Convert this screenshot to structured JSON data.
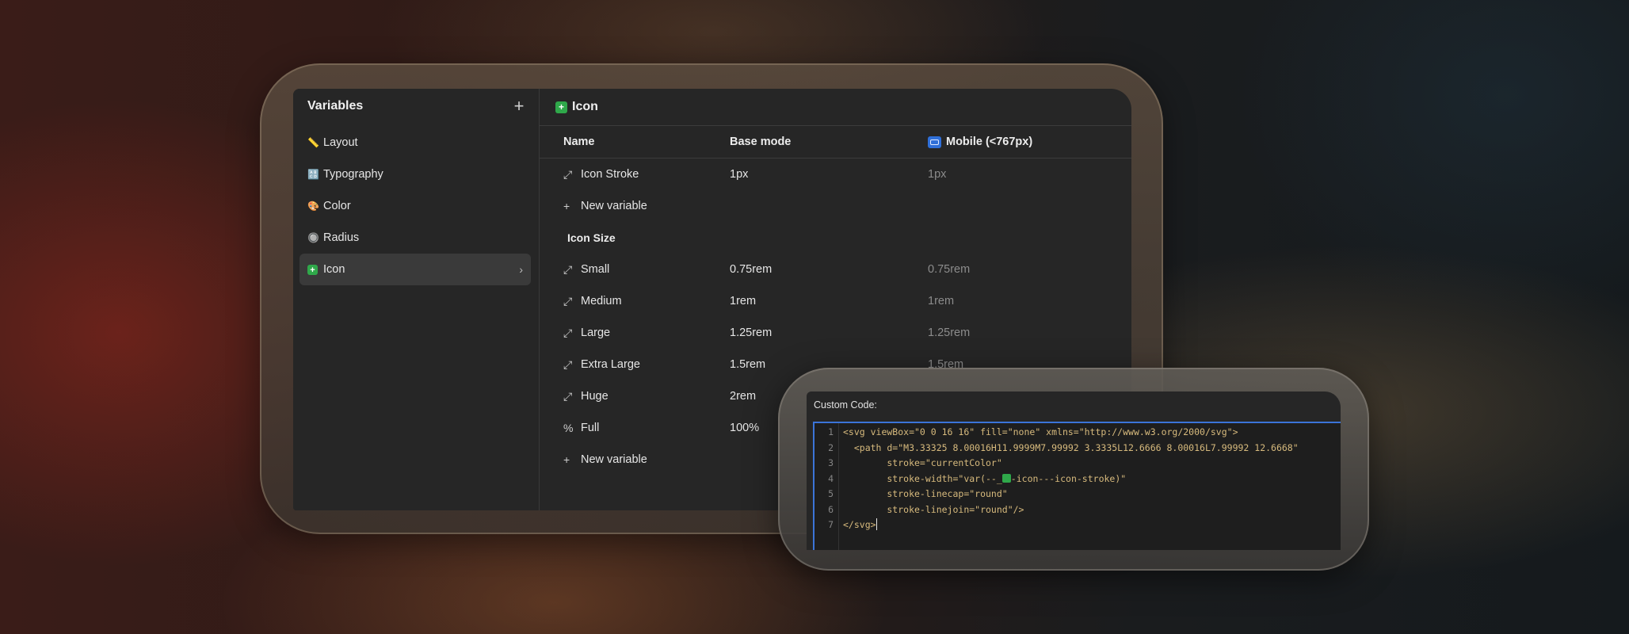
{
  "sidebar": {
    "title": "Variables",
    "add_icon": "plus-icon",
    "items": [
      {
        "emoji": "📏",
        "label": "Layout"
      },
      {
        "emoji": "🔠",
        "label": "Typography"
      },
      {
        "emoji": "🎨",
        "label": "Color"
      },
      {
        "emoji": "🔘",
        "label": "Radius"
      },
      {
        "emoji": "✚",
        "label": "Icon",
        "active": true
      }
    ]
  },
  "main": {
    "title": "Icon",
    "columns": {
      "name": "Name",
      "base": "Base mode",
      "mobile": "Mobile (<767px)"
    },
    "rows": [
      {
        "name": "Icon Stroke",
        "base": "1px",
        "mobile": "1px"
      },
      {
        "name": "Small",
        "base": "0.75rem",
        "mobile": "0.75rem"
      },
      {
        "name": "Medium",
        "base": "1rem",
        "mobile": "1rem"
      },
      {
        "name": "Large",
        "base": "1.25rem",
        "mobile": "1.25rem"
      },
      {
        "name": "Extra Large",
        "base": "1.5rem",
        "mobile": "1.5rem"
      },
      {
        "name": "Huge",
        "base": "2rem",
        "mobile": ""
      },
      {
        "name": "Full",
        "base": "100%",
        "mobile": ""
      }
    ],
    "new_variable": "New variable",
    "section_icon_size": "Icon Size"
  },
  "code": {
    "title": "Custom Code:",
    "line_numbers": [
      "1",
      "2",
      "3",
      "4",
      "5",
      "6",
      "7"
    ],
    "l1": "<svg viewBox=\"0 0 16 16\" fill=\"none\" xmlns=\"http://www.w3.org/2000/svg\">",
    "l2": "  <path d=\"M3.33325 8.00016H11.9999M7.99992 3.3335L12.6666 8.00016L7.99992 12.6668\"",
    "l3": "        stroke=\"currentColor\"",
    "l4a": "        stroke-width=\"var(--_",
    "l4b": "-icon---icon-stroke)\"",
    "l5": "        stroke-linecap=\"round\"",
    "l6": "        stroke-linejoin=\"round\"/>",
    "l7": "</svg>"
  }
}
